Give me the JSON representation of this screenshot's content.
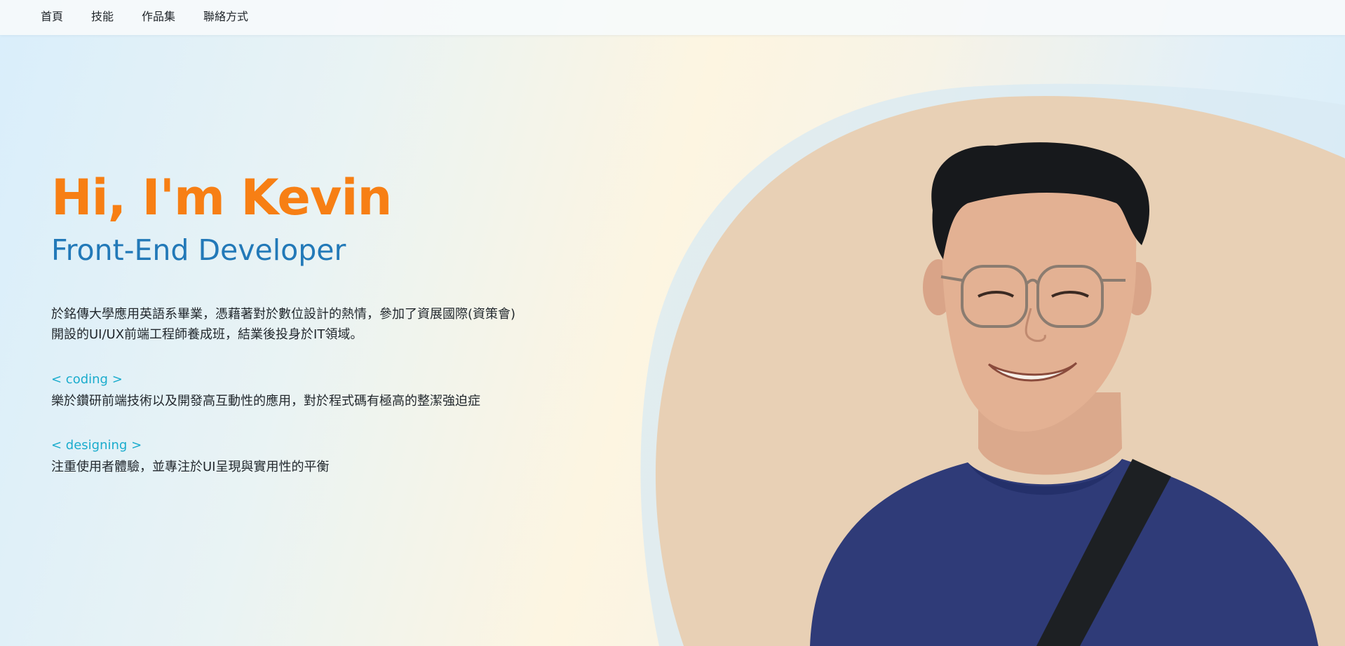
{
  "nav": {
    "items": [
      {
        "label": "首頁"
      },
      {
        "label": "技能"
      },
      {
        "label": "作品集"
      },
      {
        "label": "聯絡方式"
      }
    ]
  },
  "hero": {
    "greeting": "Hi, I'm Kevin",
    "role": "Front-End Developer",
    "intro": "於銘傳大學應用英語系畢業，憑藉著對於數位設計的熱情，參加了資展國際(資策會)開設的UI/UX前端工程師養成班，結業後投身於IT領域。",
    "coding_tag": "< coding >",
    "coding_desc": "樂於鑽研前端技術以及開發高互動性的應用，對於程式碼有極高的整潔強迫症",
    "designing_tag": "< designing >",
    "designing_desc": "注重使用者體驗，並專注於UI呈現與實用性的平衡"
  },
  "colors": {
    "accent_orange": "#f77f14",
    "role_blue": "#2279b8",
    "tag_cyan": "#1aaccd",
    "portrait_bg": "#e8d0b5"
  }
}
